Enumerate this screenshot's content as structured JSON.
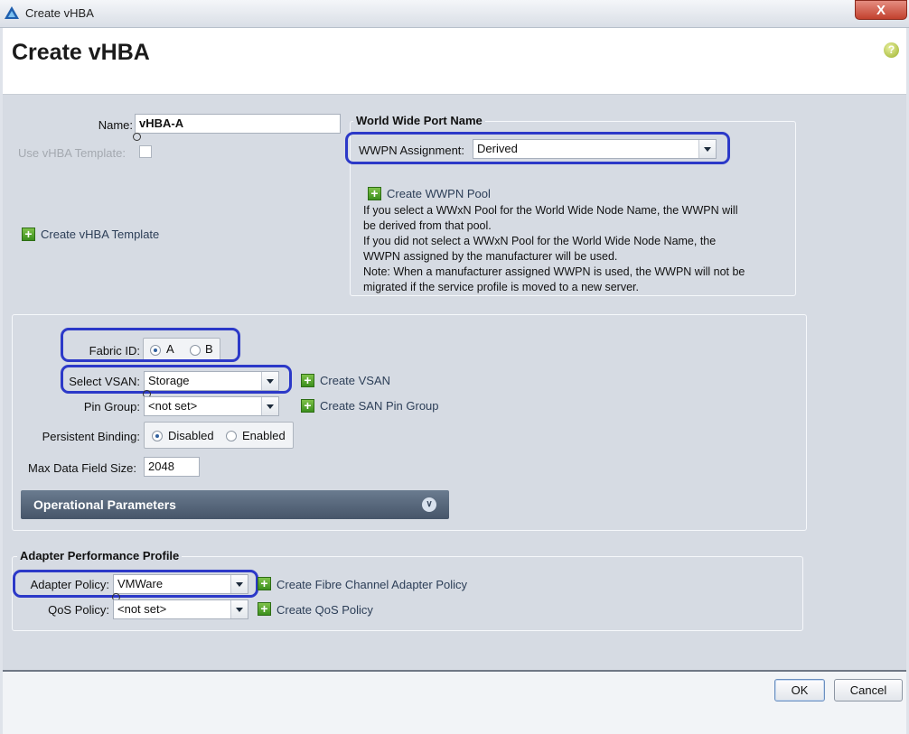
{
  "window": {
    "title": "Create vHBA",
    "close_glyph": "X"
  },
  "header": {
    "title": "Create vHBA",
    "help_glyph": "?"
  },
  "form": {
    "name_label": "Name:",
    "name_value": "vHBA-A",
    "use_template_label": "Use vHBA Template:",
    "create_template_link": "Create vHBA Template"
  },
  "wwpn": {
    "legend": "World Wide Port Name",
    "assignment_label": "WWPN Assignment:",
    "assignment_value": "Derived",
    "create_pool_link": "Create WWPN Pool",
    "notes": [
      "If you select a WWxN Pool for the World Wide Node Name, the WWPN will",
      "be derived from that pool.",
      "If you did not select a WWxN Pool for the World Wide Node Name, the",
      "WWPN assigned by the manufacturer will be used.",
      "Note: When a manufacturer assigned WWPN is used, the WWPN will not be",
      "migrated if the service profile is moved to a new server."
    ]
  },
  "fabric": {
    "fabric_id_label": "Fabric ID:",
    "fabric_options": [
      "A",
      "B"
    ],
    "fabric_selected": "A",
    "vsan_label": "Select VSAN:",
    "vsan_value": "Storage",
    "create_vsan_link": "Create VSAN",
    "pin_group_label": "Pin Group:",
    "pin_group_value": "<not set>",
    "create_pin_group_link": "Create SAN Pin Group",
    "persistent_label": "Persistent Binding:",
    "persistent_options": [
      "Disabled",
      "Enabled"
    ],
    "persistent_selected": "Disabled",
    "max_field_label": "Max Data Field Size:",
    "max_field_value": "2048",
    "operational_label": "Operational Parameters"
  },
  "adapter": {
    "legend": "Adapter Performance Profile",
    "policy_label": "Adapter Policy:",
    "policy_value": "VMWare",
    "create_policy_link": "Create Fibre Channel Adapter Policy",
    "qos_label": "QoS Policy:",
    "qos_value": "<not set>",
    "create_qos_link": "Create QoS Policy"
  },
  "footer": {
    "ok": "OK",
    "cancel": "Cancel"
  },
  "colors": {
    "highlight": "#2c39c8",
    "plus_icon": "#3b8f1d",
    "close": "#c2412e"
  },
  "icons": [
    "app-triangle-icon",
    "close-icon",
    "help-icon",
    "plus-icon",
    "chevron-down-icon",
    "double-chevron-down-icon"
  ]
}
